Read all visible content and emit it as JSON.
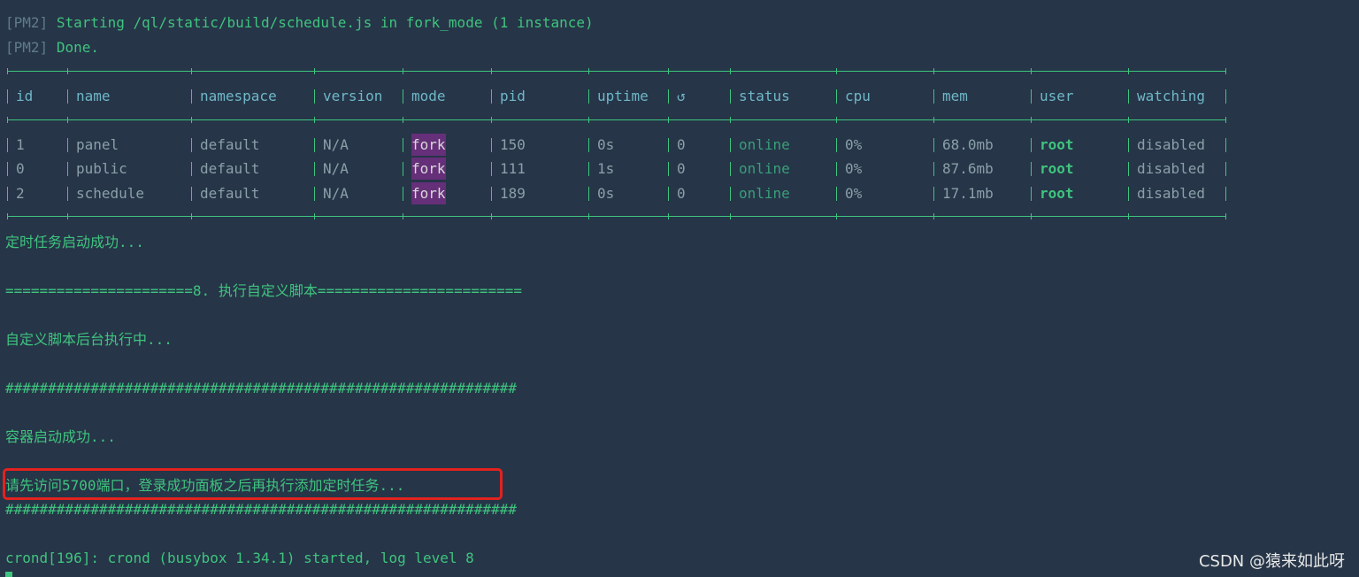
{
  "pm2": {
    "tag": "[PM2]",
    "starting": "Starting /ql/static/build/schedule.js in fork_mode (1 instance)",
    "done": "Done."
  },
  "table": {
    "headers": {
      "id": "id",
      "name": "name",
      "namespace": "namespace",
      "version": "version",
      "mode": "mode",
      "pid": "pid",
      "uptime": "uptime",
      "restart": "↺",
      "status": "status",
      "cpu": "cpu",
      "mem": "mem",
      "user": "user",
      "watching": "watching"
    },
    "rows": [
      {
        "id": "1",
        "name": "panel",
        "namespace": "default",
        "version": "N/A",
        "mode": "fork",
        "pid": "150",
        "uptime": "0s",
        "restart": "0",
        "status": "online",
        "cpu": "0%",
        "mem": "68.0mb",
        "user": "root",
        "watching": "disabled"
      },
      {
        "id": "0",
        "name": "public",
        "namespace": "default",
        "version": "N/A",
        "mode": "fork",
        "pid": "111",
        "uptime": "1s",
        "restart": "0",
        "status": "online",
        "cpu": "0%",
        "mem": "87.6mb",
        "user": "root",
        "watching": "disabled"
      },
      {
        "id": "2",
        "name": "schedule",
        "namespace": "default",
        "version": "N/A",
        "mode": "fork",
        "pid": "189",
        "uptime": "0s",
        "restart": "0",
        "status": "online",
        "cpu": "0%",
        "mem": "17.1mb",
        "user": "root",
        "watching": "disabled"
      }
    ]
  },
  "log": {
    "schedule_ok": "定时任务启动成功...",
    "step8": "======================8. 执行自定义脚本========================",
    "custom_running": "自定义脚本后台执行中...",
    "hash1": "############################################################",
    "container_ok": "容器启动成功...",
    "visit_hint": "请先访问5700端口，登录成功面板之后再执行添加定时任务...",
    "hash2": "############################################################",
    "crond": "crond[196]: crond (busybox 1.34.1) started, log level 8"
  },
  "watermark": "CSDN @猿来如此呀"
}
